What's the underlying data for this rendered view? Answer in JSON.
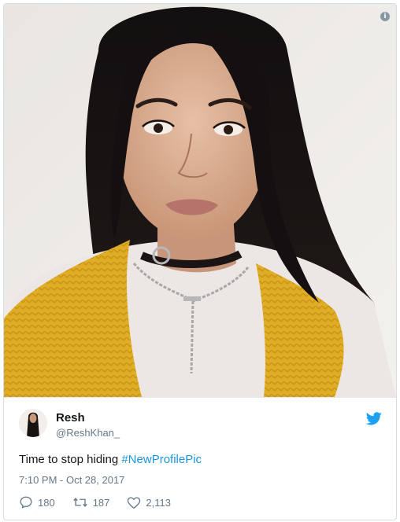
{
  "photo": {
    "alt": "Selfie of a woman with long dark hair wearing a yellow knit vest, white turtleneck and chain necklace"
  },
  "tweet": {
    "author_name": "Resh",
    "author_handle": "@ReshKhan_",
    "text_plain": "Time to stop hiding ",
    "hashtag": "#NewProfilePic",
    "timestamp": "7:10 PM - Oct 28, 2017",
    "replies": "180",
    "retweets": "187",
    "likes": "2,113"
  },
  "icons": {
    "info": "info-icon",
    "brand": "twitter-bird-icon",
    "reply": "reply-icon",
    "retweet": "retweet-icon",
    "like": "heart-icon"
  },
  "colors": {
    "brand": "#1da1f2",
    "hashtag": "#1b95e0",
    "secondary_text": "#657786"
  }
}
